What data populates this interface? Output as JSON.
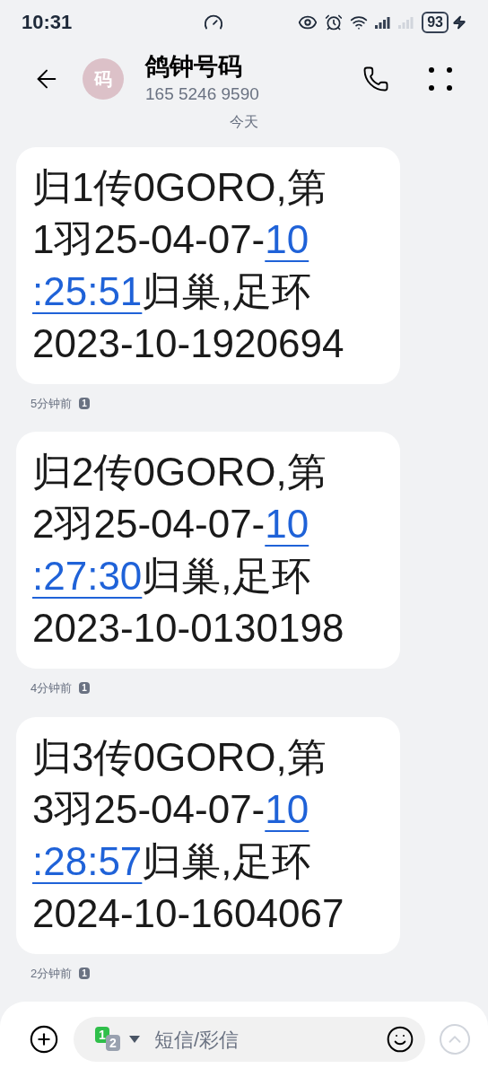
{
  "status_bar": {
    "time": "10:31",
    "battery": "93"
  },
  "header": {
    "avatar": "码",
    "name": "鸽钟号码",
    "number": "165 5246 9590"
  },
  "date_divider": "今天",
  "messages": [
    {
      "lines": [
        [
          {
            "kind": "text",
            "text": "归1传0GORO,第"
          }
        ],
        [
          {
            "kind": "text",
            "text": "1羽25-04-07-"
          },
          {
            "kind": "link",
            "text": "10"
          }
        ],
        [
          {
            "kind": "link",
            "text": ":25:51"
          },
          {
            "kind": "text",
            "text": "归巢,足环"
          }
        ],
        [
          {
            "kind": "text",
            "text": "2023-10-1920694"
          }
        ]
      ],
      "time": "5分钟前",
      "sim": "1"
    },
    {
      "lines": [
        [
          {
            "kind": "text",
            "text": "归2传0GORO,第"
          }
        ],
        [
          {
            "kind": "text",
            "text": "2羽25-04-07-"
          },
          {
            "kind": "link",
            "text": "10"
          }
        ],
        [
          {
            "kind": "link",
            "text": ":27:30"
          },
          {
            "kind": "text",
            "text": "归巢,足环"
          }
        ],
        [
          {
            "kind": "text",
            "text": "2023-10-0130198"
          }
        ]
      ],
      "time": "4分钟前",
      "sim": "1"
    },
    {
      "lines": [
        [
          {
            "kind": "text",
            "text": "归3传0GORO,第"
          }
        ],
        [
          {
            "kind": "text",
            "text": "3羽25-04-07-"
          },
          {
            "kind": "link",
            "text": "10"
          }
        ],
        [
          {
            "kind": "link",
            "text": ":28:57"
          },
          {
            "kind": "text",
            "text": "归巢,足环"
          }
        ],
        [
          {
            "kind": "text",
            "text": "2024-10-1604067"
          }
        ]
      ],
      "time": "2分钟前",
      "sim": "1"
    }
  ],
  "composer": {
    "sim_primary": "1",
    "sim_secondary": "2",
    "placeholder": "短信/彩信"
  }
}
